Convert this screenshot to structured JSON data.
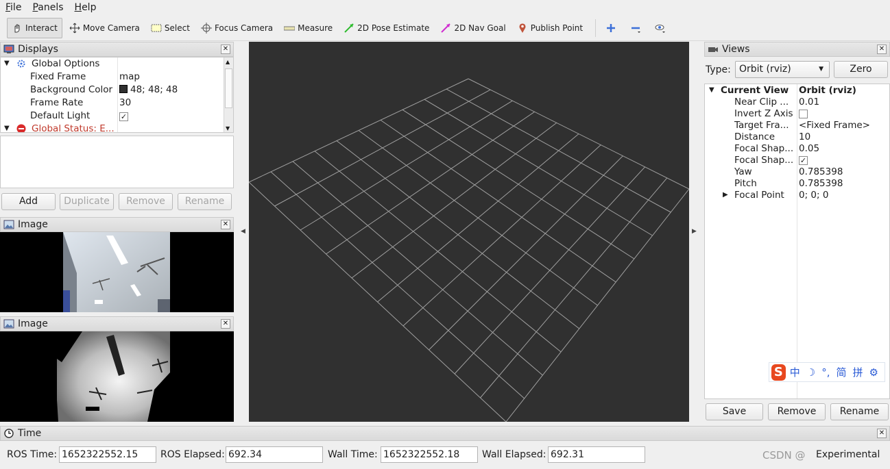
{
  "menubar": {
    "items": [
      "File",
      "Panels",
      "Help"
    ]
  },
  "toolbar": {
    "tools": [
      {
        "label": "Interact",
        "icon": "hand-icon"
      },
      {
        "label": "Move Camera",
        "icon": "move-icon"
      },
      {
        "label": "Select",
        "icon": "select-box-icon"
      },
      {
        "label": "Focus Camera",
        "icon": "crosshair-icon"
      },
      {
        "label": "Measure",
        "icon": "ruler-icon"
      },
      {
        "label": "2D Pose Estimate",
        "icon": "green-arrow-icon"
      },
      {
        "label": "2D Nav Goal",
        "icon": "magenta-arrow-icon"
      },
      {
        "label": "Publish Point",
        "icon": "map-pin-icon"
      }
    ],
    "extra_icons": [
      "plus-icon",
      "minus-icon",
      "eye-icon"
    ]
  },
  "displays": {
    "title": "Displays",
    "tree": [
      {
        "key": "Global Options",
        "value": ""
      },
      {
        "key": "Fixed Frame",
        "value": "map"
      },
      {
        "key": "Background Color",
        "value": "48; 48; 48"
      },
      {
        "key": "Frame Rate",
        "value": "30"
      },
      {
        "key": "Default Light",
        "value": "✓"
      },
      {
        "key": "Global Status: E...",
        "value": ""
      }
    ],
    "buttons": {
      "add": "Add",
      "duplicate": "Duplicate",
      "remove": "Remove",
      "rename": "Rename"
    }
  },
  "image_panels": [
    {
      "title": "Image"
    },
    {
      "title": "Image"
    }
  ],
  "views": {
    "title": "Views",
    "type_label": "Type:",
    "type_value": "Orbit (rviz)",
    "zero_label": "Zero",
    "tree": [
      {
        "key": "Current View",
        "value": "Orbit (rviz)"
      },
      {
        "key": "Near Clip ...",
        "value": "0.01"
      },
      {
        "key": "Invert Z Axis",
        "value": ""
      },
      {
        "key": "Target Fra...",
        "value": "<Fixed Frame>"
      },
      {
        "key": "Distance",
        "value": "10"
      },
      {
        "key": "Focal Shap...",
        "value": "0.05"
      },
      {
        "key": "Focal Shap...",
        "value": "✓"
      },
      {
        "key": "Yaw",
        "value": "0.785398"
      },
      {
        "key": "Pitch",
        "value": "0.785398"
      },
      {
        "key": "Focal Point",
        "value": "0; 0; 0"
      }
    ],
    "buttons": {
      "save": "Save",
      "remove": "Remove",
      "rename": "Rename"
    }
  },
  "ime": {
    "logo": "S",
    "glyphs": [
      "中",
      "☽",
      "°,",
      "简",
      "拼",
      "⚙"
    ]
  },
  "time": {
    "title": "Time",
    "ros_time_label": "ROS Time:",
    "ros_time": "1652322552.15",
    "ros_elapsed_label": "ROS Elapsed:",
    "ros_elapsed": "692.34",
    "wall_time_label": "Wall Time:",
    "wall_time": "1652322552.18",
    "wall_elapsed_label": "Wall Elapsed:",
    "wall_elapsed": "692.31",
    "mode": "Experimental"
  },
  "watermark": "CSDN @",
  "colors": {
    "viewport_bg": "#303030",
    "grid": "#a0a0a0",
    "status_error": "#c0392b"
  }
}
